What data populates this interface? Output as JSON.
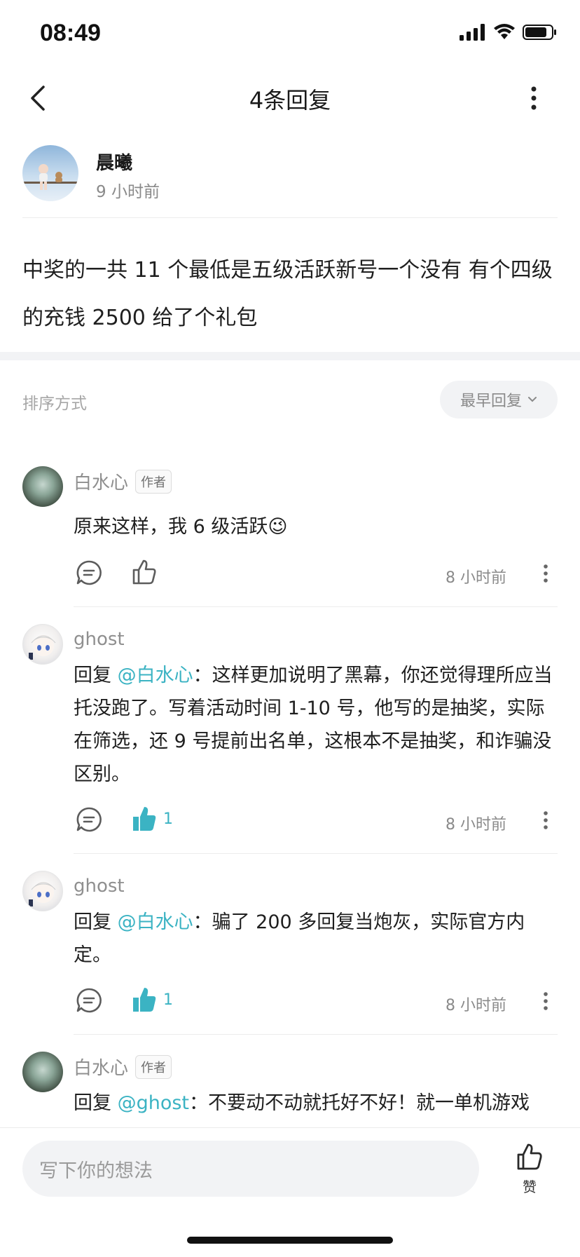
{
  "status_bar": {
    "time": "08:49"
  },
  "nav": {
    "title": "4条回复"
  },
  "post": {
    "author": "晨曦",
    "time": "9 小时前",
    "content": "中奖的一共 11 个最低是五级活跃新号一个没有 有个四级的充钱 2500 给了个礼包"
  },
  "sort": {
    "label": "排序方式",
    "selected": "最早回复"
  },
  "comments": [
    {
      "author": "白水心",
      "badge": "作者",
      "text": "原来这样，我 6 级活跃😉",
      "time": "8 小时前",
      "likes": ""
    },
    {
      "author": "ghost",
      "reply_prefix": "回复 ",
      "mention": "@白水心",
      "text": "：这样更加说明了黑幕，你还觉得理所应当托没跑了。写着活动时间 1-10 号，他写的是抽奖，实际在筛选，还 9 号提前出名单，这根本不是抽奖，和诈骗没区别。",
      "time": "8 小时前",
      "likes": "1"
    },
    {
      "author": "ghost",
      "reply_prefix": "回复 ",
      "mention": "@白水心",
      "text": "：骗了 200 多回复当炮灰，实际官方内定。",
      "time": "8 小时前",
      "likes": "1"
    },
    {
      "author": "白水心",
      "badge": "作者",
      "reply_prefix": "回复 ",
      "mention": "@ghost",
      "text": "：不要动不动就托好不好！就一单机游戏"
    }
  ],
  "composer": {
    "placeholder": "写下你的想法",
    "like_label": "赞"
  },
  "colors": {
    "accent": "#3bb3c3",
    "muted": "#8a8a8a",
    "band": "#f2f3f5"
  }
}
